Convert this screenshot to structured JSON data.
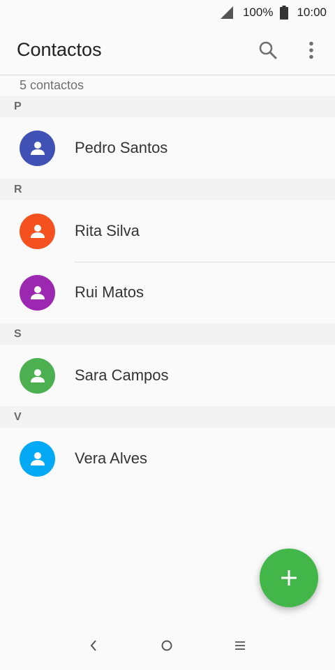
{
  "status_bar": {
    "battery": "100%",
    "time": "10:00",
    "signal_icon": "signal-icon",
    "battery_icon": "battery-icon"
  },
  "app_bar": {
    "title": "Contactos",
    "search_icon": "search-icon",
    "more_icon": "more-vert-icon"
  },
  "contacts_count": "5 contactos",
  "sections": [
    {
      "letter": "P",
      "contacts": [
        {
          "name": "Pedro Santos",
          "color": "#3f51b5"
        }
      ]
    },
    {
      "letter": "R",
      "contacts": [
        {
          "name": "Rita Silva",
          "color": "#f4511e"
        },
        {
          "name": "Rui Matos",
          "color": "#9c27b0"
        }
      ]
    },
    {
      "letter": "S",
      "contacts": [
        {
          "name": "Sara Campos",
          "color": "#4caf50"
        }
      ]
    },
    {
      "letter": "V",
      "contacts": [
        {
          "name": "Vera Alves",
          "color": "#03a9f4"
        }
      ]
    }
  ],
  "fab": {
    "icon": "add-icon",
    "color": "#43b649"
  },
  "nav_bar": {
    "back_icon": "back-icon",
    "home_icon": "home-icon",
    "recents_icon": "recents-icon"
  }
}
